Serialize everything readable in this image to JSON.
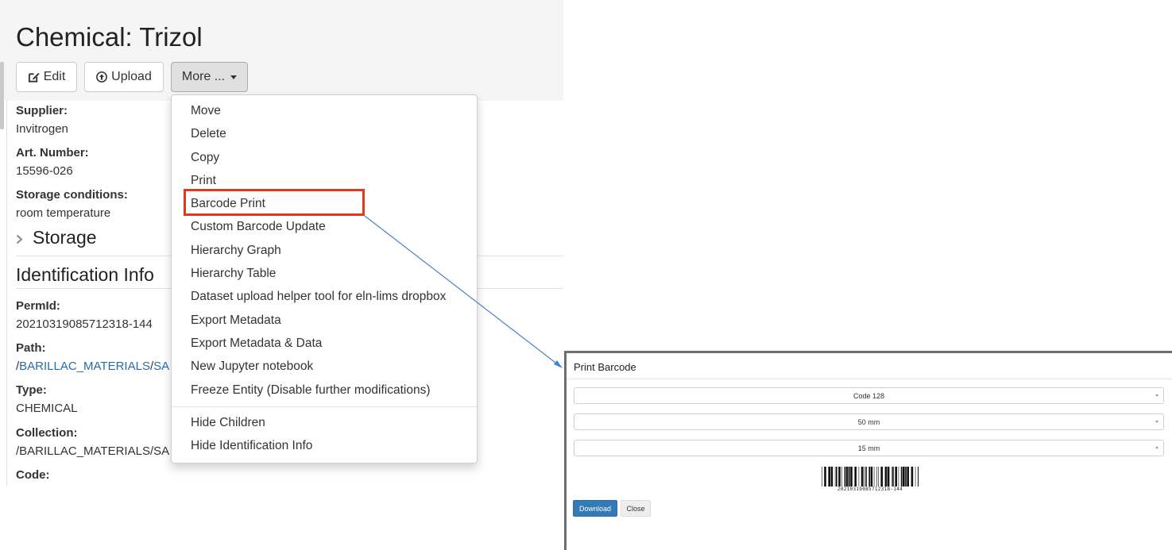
{
  "page": {
    "title": "Chemical: Trizol",
    "toolbar": {
      "edit_label": "Edit",
      "upload_label": "Upload",
      "more_label": "More ..."
    },
    "fields": {
      "supplier_label": "Supplier:",
      "supplier_value": "Invitrogen",
      "art_label": "Art. Number:",
      "art_value": "15596-026",
      "storage_cond_label": "Storage conditions:",
      "storage_cond_value": "room temperature"
    },
    "storage_section": "Storage",
    "identification": {
      "heading": "Identification Info",
      "permid_label": "PermId:",
      "permid_value": "20210319085712318-144",
      "path_label": "Path:",
      "path_prefix": "/",
      "path_link1": "BARILLAC_MATERIALS",
      "path_sep": "/",
      "path_link2": "SA",
      "type_label": "Type:",
      "type_value": "CHEMICAL",
      "collection_label": "Collection:",
      "collection_value": "/BARILLAC_MATERIALS/SA",
      "code_label": "Code:"
    }
  },
  "menu": {
    "items": [
      "Move",
      "Delete",
      "Copy",
      "Print",
      "Barcode Print",
      "Custom Barcode Update",
      "Hierarchy Graph",
      "Hierarchy Table",
      "Dataset upload helper tool for eln-lims dropbox",
      "Export Metadata",
      "Export Metadata & Data",
      "New Jupyter notebook",
      "Freeze Entity (Disable further modifications)"
    ],
    "extra_items": [
      "Hide Children",
      "Hide Identification Info"
    ],
    "highlighted": "Barcode Print"
  },
  "dialog": {
    "title": "Print Barcode",
    "barcode_type": "Code 128",
    "width": "50 mm",
    "height": "15 mm",
    "barcode_text": "20210319085712318-144",
    "download_label": "Download",
    "close_label": "Close"
  },
  "colors": {
    "highlight": "#e8361a",
    "link": "#2a6aa9",
    "primary": "#337ab7",
    "arrow": "#4a7fcf"
  }
}
